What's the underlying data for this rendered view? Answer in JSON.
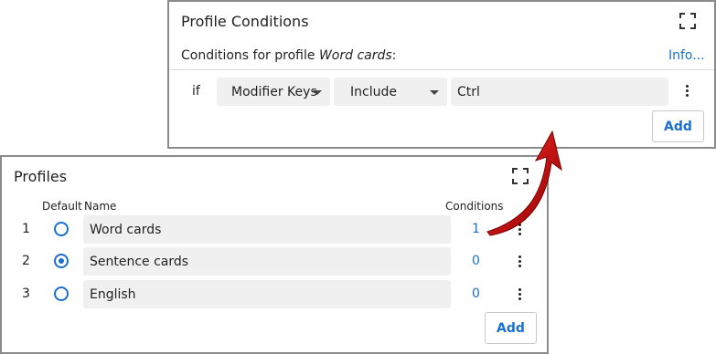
{
  "conditions_panel": {
    "title": "Profile Conditions",
    "subtitle_prefix": "Conditions for profile ",
    "subtitle_profile": "Word cards",
    "subtitle_suffix": ":",
    "info_link": "Info...",
    "condition": {
      "keyword": "if",
      "type": "Modifier Keys",
      "operator": "Include",
      "value": "Ctrl"
    },
    "add_label": "Add"
  },
  "profiles_panel": {
    "title": "Profiles",
    "headers": {
      "default": "Default",
      "name": "Name",
      "conditions": "Conditions"
    },
    "rows": [
      {
        "num": "1",
        "name": "Word cards",
        "conditions": "1",
        "selected": false
      },
      {
        "num": "2",
        "name": "Sentence cards",
        "conditions": "0",
        "selected": true
      },
      {
        "num": "3",
        "name": "English",
        "conditions": "0",
        "selected": false
      }
    ],
    "add_label": "Add"
  },
  "colors": {
    "accent": "#1a6fd1",
    "arrow": "#c40000",
    "field_bg": "#f0f0f0"
  }
}
